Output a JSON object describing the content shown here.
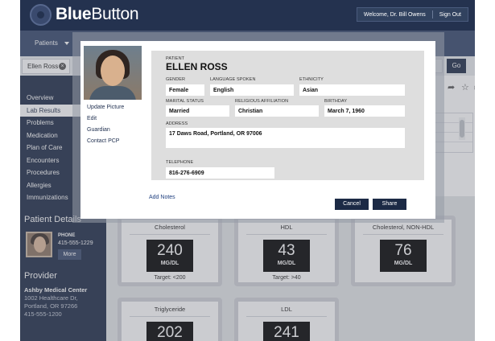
{
  "header": {
    "brand_bold": "Blue",
    "brand_regular": "Button",
    "welcome": "Welcome, Dr. Bill Owens",
    "sign_out": "Sign Out"
  },
  "nav": {
    "patients_label": "Patients"
  },
  "search": {
    "patient_chip": "Ellen Ross",
    "chip_close": "×",
    "go_label": "Go"
  },
  "sidebar": {
    "items": [
      {
        "label": "Overview"
      },
      {
        "label": "Lab Results"
      },
      {
        "label": "Problems"
      },
      {
        "label": "Medication"
      },
      {
        "label": "Plan of Care"
      },
      {
        "label": "Encounters"
      },
      {
        "label": "Procedures"
      },
      {
        "label": "Allergies"
      },
      {
        "label": "Immunizations"
      }
    ],
    "patient_details_title": "Patient Details",
    "phone_label": "PHONE",
    "phone_value": "415-555-1229",
    "more_label": "More",
    "provider_title": "Provider",
    "provider_name": "Ashby Medical Center",
    "provider_address_1": "1002 Healthcare Dr,",
    "provider_address_2": "Portland, OR 97266",
    "provider_phone": "415-555-1200"
  },
  "toolbar": {
    "share_icon": "share-icon",
    "star_icon": "star-icon",
    "print_icon": "print-icon"
  },
  "labs": {
    "cards": [
      {
        "title": "Cholesterol",
        "value": "240",
        "unit": "MG/DL",
        "target": "Target: <200"
      },
      {
        "title": "HDL",
        "value": "43",
        "unit": "MG/DL",
        "target": "Target: >40"
      },
      {
        "title": "Cholesterol, NON-HDL",
        "value": "76",
        "unit": "MG/DL",
        "target": ""
      },
      {
        "title": "Triglyceride",
        "value": "202",
        "unit": "",
        "target": ""
      },
      {
        "title": "LDL",
        "value": "241",
        "unit": "",
        "target": ""
      }
    ]
  },
  "modal": {
    "links": [
      "Update Picture",
      "Edit",
      "Guardian",
      "Contact PCP"
    ],
    "add_notes": "Add Notes",
    "patient_label": "PATIENT",
    "patient_name": "ELLEN ROSS",
    "gender_label": "GENDER",
    "gender": "Female",
    "language_label": "LANGUAGE SPOKEN",
    "language": "English",
    "ethnicity_label": "ETHNICITY",
    "ethnicity": "Asian",
    "marital_label": "MARITAL STATUS",
    "marital": "Married",
    "religion_label": "RELIGIOUS AFFILIATION",
    "religion": "Christian",
    "birthday_label": "BIRTHDAY",
    "birthday": "March 7, 1960",
    "address_label": "ADDRESS",
    "address": "17 Daws Road, Portland, OR 97006",
    "telephone_label": "TELEPHONE",
    "telephone": "816-276-6909",
    "cancel_label": "Cancel",
    "share_label": "Share"
  }
}
